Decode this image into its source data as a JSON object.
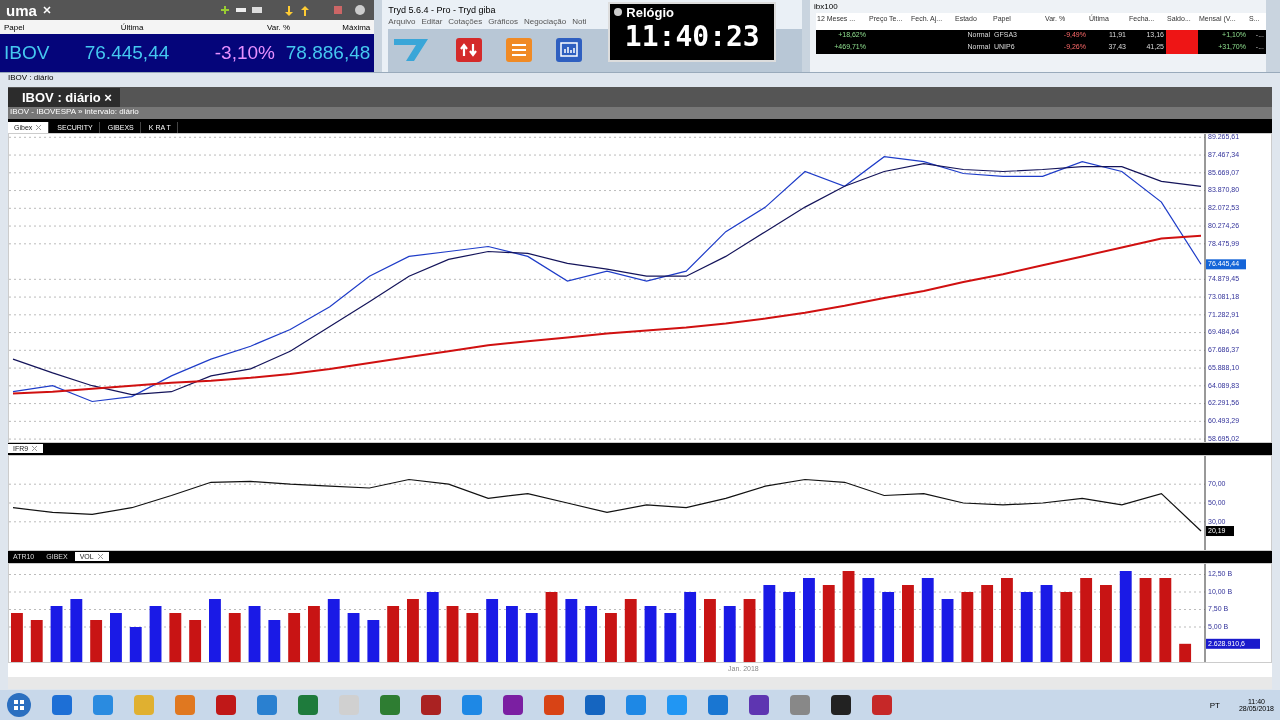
{
  "quote_widget": {
    "title": "uma",
    "columns": [
      "Papel",
      "Última",
      "Var. %",
      "Máxima"
    ],
    "row": [
      "IBOV",
      "76.445,44",
      "-3,10%",
      "78.886,48"
    ]
  },
  "tryd_window": {
    "title": "Tryd 5.6.4 - Pro - Tryd giba",
    "menu": [
      "Arquivo",
      "Editar",
      "Cotações",
      "Gráficos",
      "Negociação",
      "Noti"
    ]
  },
  "clock": {
    "title": "Relógio",
    "time": "11:40:23"
  },
  "ibx_table": {
    "title": "ibx100",
    "columns": [
      "12 Meses ...",
      "Preço Te...",
      "Fech. Aj...",
      "Estado",
      "Papel",
      "Var. %",
      "Última",
      "Fecha...",
      "Saldo...",
      "Mensal (V...",
      "S..."
    ],
    "rows": [
      {
        "twelve_months": "+18,62%",
        "estado": "Normal",
        "papel": "GFSA3",
        "var": "-9,49%",
        "ultima": "11,91",
        "fecha": "13,16",
        "mensal": "+1,10%",
        "s": "-..."
      },
      {
        "twelve_months": "+469,71%",
        "estado": "Normal",
        "papel": "UNIP6",
        "var": "-9,26%",
        "ultima": "37,43",
        "fecha": "41,25",
        "mensal": "+31,70%",
        "s": "-..."
      }
    ]
  },
  "chart_window": {
    "title": "IBOV : diário",
    "tab": "IBOV : diário",
    "tab_close": "×",
    "subtitle": "IBOV - IBOVESPA » intervalo: diário",
    "tabs": [
      {
        "label": "Gibex",
        "selected": true
      },
      {
        "label": "SECURITY",
        "selected": false
      },
      {
        "label": "GIBEXS",
        "selected": false
      },
      {
        "label": "K RA T",
        "selected": false
      }
    ]
  },
  "price_panel": {
    "chart_data": {
      "type": "line",
      "grid": true,
      "ylim": [
        58400,
        89600
      ],
      "yticks": [
        {
          "value": 58695.02,
          "label": "58.695,02"
        },
        {
          "value": 60493.29,
          "label": "60.493,29"
        },
        {
          "value": 62291.56,
          "label": "62.291,56"
        },
        {
          "value": 64089.83,
          "label": "64.089,83"
        },
        {
          "value": 65888.1,
          "label": "65.888,10"
        },
        {
          "value": 67686.37,
          "label": "67.686,37"
        },
        {
          "value": 69484.64,
          "label": "69.484,64"
        },
        {
          "value": 71282.91,
          "label": "71.282,91"
        },
        {
          "value": 73081.18,
          "label": "73.081,18"
        },
        {
          "value": 74879.45,
          "label": "74.879,45"
        },
        {
          "value": 78475.99,
          "label": "78.475,99"
        },
        {
          "value": 80274.26,
          "label": "80.274,26"
        },
        {
          "value": 82072.53,
          "label": "82.072,53"
        },
        {
          "value": 83870.8,
          "label": "83.870,80"
        },
        {
          "value": 85669.07,
          "label": "85.669,07"
        },
        {
          "value": 87467.34,
          "label": "87.467,34"
        },
        {
          "value": 89265.61,
          "label": "89.265,61"
        }
      ],
      "series": [
        {
          "color": "#1e3cc8",
          "values": [
            63500,
            64100,
            62500,
            63000,
            65100,
            66800,
            68100,
            69800,
            72100,
            75200,
            77200,
            77700,
            78200,
            77200,
            74700,
            75700,
            74700,
            75700,
            79700,
            82200,
            85800,
            84300,
            87300,
            86800,
            85600,
            85300,
            85300,
            86800,
            85800,
            82700,
            76400
          ]
        },
        {
          "color": "#14145a",
          "values": [
            66800,
            65400,
            64100,
            63200,
            63500,
            65100,
            65800,
            67600,
            70100,
            72600,
            75200,
            76900,
            77700,
            77500,
            76500,
            75900,
            75200,
            75200,
            77200,
            79700,
            82200,
            84300,
            85800,
            86600,
            86000,
            85800,
            86000,
            86300,
            86300,
            84800,
            84300
          ]
        },
        {
          "color": "#d01010",
          "values": [
            63300,
            63500,
            63800,
            64100,
            64400,
            64600,
            64900,
            65300,
            65800,
            66400,
            67000,
            67600,
            68200,
            68600,
            69000,
            69400,
            69700,
            70000,
            70400,
            70900,
            71500,
            72200,
            73000,
            73700,
            74600,
            75400,
            76300,
            77200,
            78100,
            79000,
            79300
          ]
        }
      ],
      "annotations": [
        "76.445,44"
      ]
    }
  },
  "rsi_panel": {
    "tabs": [
      {
        "label": "IFR9",
        "selected": true
      }
    ],
    "chart_data": {
      "type": "line",
      "grid": true,
      "ylim": [
        0,
        100
      ],
      "yticks": [
        {
          "value": 30,
          "label": "30,00"
        },
        {
          "value": 50,
          "label": "50,00"
        },
        {
          "value": 70,
          "label": "70,00"
        }
      ],
      "series": [
        {
          "color": "#111111",
          "values": [
            45,
            40,
            38,
            45,
            58,
            72,
            73,
            70,
            68,
            66,
            75,
            70,
            55,
            60,
            50,
            40,
            48,
            45,
            55,
            68,
            75,
            72,
            58,
            60,
            50,
            48,
            50,
            55,
            48,
            60,
            20.19
          ]
        }
      ],
      "annotations": [
        "20,19"
      ]
    }
  },
  "volume_panel": {
    "tabs": [
      {
        "label": "ATR10",
        "selected": false
      },
      {
        "label": "GIBEX",
        "selected": false
      },
      {
        "label": "VOL",
        "selected": true
      }
    ],
    "date_label": "Jan. 2018",
    "chart_data": {
      "type": "bar",
      "grid": true,
      "ylim": [
        0,
        14
      ],
      "yticks": [
        {
          "value": 5,
          "label": "5,00 B"
        },
        {
          "value": 7.5,
          "label": "7,50 B"
        },
        {
          "value": 10,
          "label": "10,00 B"
        },
        {
          "value": 12.5,
          "label": "12,50 B"
        }
      ],
      "series": [
        {
          "color": "#c81414",
          "values": [
            7,
            6,
            null,
            null,
            6,
            null,
            null,
            null,
            7,
            6,
            null,
            7,
            null,
            null,
            7,
            8,
            null,
            null,
            null,
            8,
            9,
            null,
            8,
            7,
            null,
            null,
            null,
            10,
            null,
            null,
            7,
            9,
            null,
            null,
            null,
            9,
            null,
            9,
            null,
            null,
            null,
            11,
            13,
            null,
            null,
            11,
            null,
            null,
            10,
            11,
            12,
            null,
            null,
            10,
            12,
            11,
            null,
            12,
            12,
            2.6
          ]
        },
        {
          "color": "#1a1ae6",
          "values": [
            null,
            null,
            8,
            9,
            null,
            7,
            5,
            8,
            null,
            null,
            9,
            null,
            8,
            6,
            null,
            null,
            9,
            7,
            6,
            null,
            null,
            10,
            null,
            null,
            9,
            8,
            7,
            null,
            9,
            8,
            null,
            null,
            8,
            7,
            10,
            null,
            8,
            null,
            11,
            10,
            12,
            null,
            null,
            12,
            10,
            null,
            12,
            9,
            null,
            null,
            null,
            10,
            11,
            null,
            null,
            null,
            13,
            null,
            null,
            null
          ]
        }
      ],
      "annotations": [
        "2.628.910,6"
      ]
    }
  },
  "taskbar": {
    "language": "PT",
    "time": "11:40",
    "date": "28/05/2018"
  }
}
